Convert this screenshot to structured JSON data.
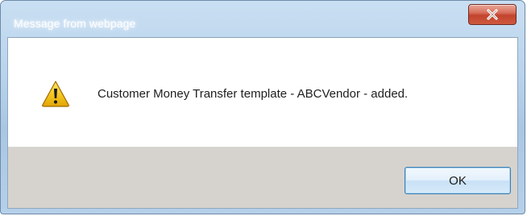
{
  "dialog": {
    "title": "Message from webpage",
    "message": "Customer Money Transfer template - ABCVendor - added.",
    "ok_label": "OK",
    "icon": "warning-icon",
    "close_icon": "close-icon"
  },
  "colors": {
    "frame_blue": "#b9d3ec",
    "close_red": "#c2432d",
    "button_bar_gray": "#d6d3ce",
    "ok_border_blue": "#3c7fb1",
    "warning_yellow": "#f3c21b"
  }
}
